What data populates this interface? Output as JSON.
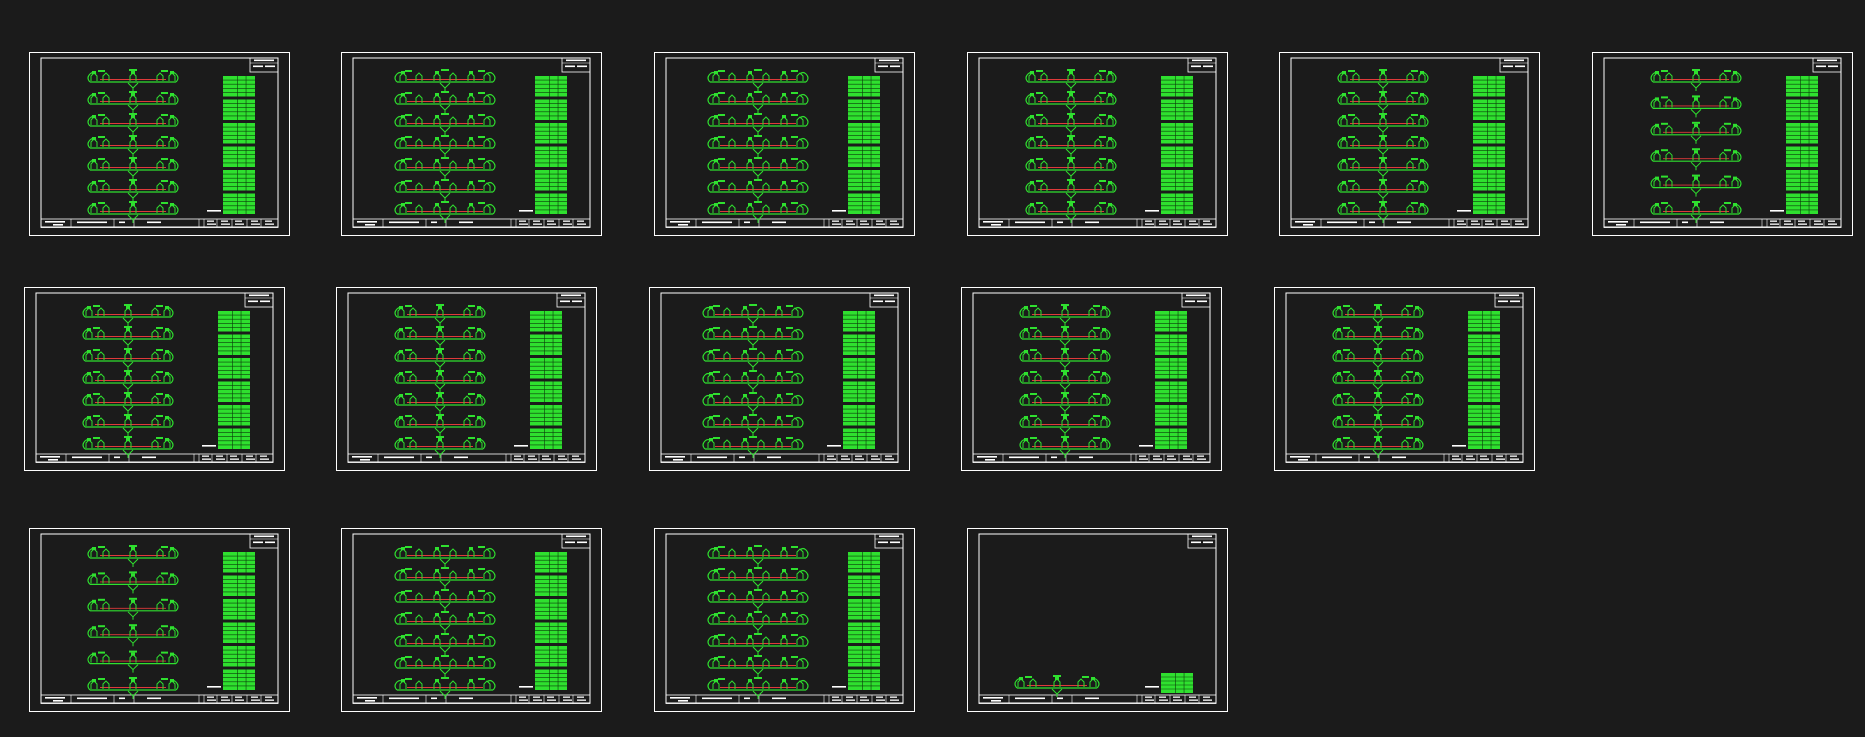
{
  "viewer": {
    "background": "#1b1b1b",
    "line_color": "#ffffff",
    "drawing_color": "#2fe02f",
    "rebar_color": "#e03a3a"
  },
  "sheets": [
    {
      "id": "sheet-1",
      "levels": 7,
      "table_blocks": 6,
      "variant": "a"
    },
    {
      "id": "sheet-2",
      "levels": 7,
      "table_blocks": 6,
      "variant": "b"
    },
    {
      "id": "sheet-3",
      "levels": 7,
      "table_blocks": 6,
      "variant": "b"
    },
    {
      "id": "sheet-4",
      "levels": 7,
      "table_blocks": 6,
      "variant": "a"
    },
    {
      "id": "sheet-5",
      "levels": 7,
      "table_blocks": 6,
      "variant": "a"
    },
    {
      "id": "sheet-6",
      "levels": 6,
      "table_blocks": 6,
      "variant": "a"
    },
    {
      "id": "sheet-7",
      "levels": 7,
      "table_blocks": 6,
      "variant": "a"
    },
    {
      "id": "sheet-8",
      "levels": 7,
      "table_blocks": 6,
      "variant": "a"
    },
    {
      "id": "sheet-9",
      "levels": 7,
      "table_blocks": 6,
      "variant": "b"
    },
    {
      "id": "sheet-10",
      "levels": 7,
      "table_blocks": 6,
      "variant": "a"
    },
    {
      "id": "sheet-11",
      "levels": 7,
      "table_blocks": 6,
      "variant": "a"
    },
    {
      "id": "sheet-12",
      "levels": 6,
      "table_blocks": 6,
      "variant": "a"
    },
    {
      "id": "sheet-13",
      "levels": 7,
      "table_blocks": 6,
      "variant": "b"
    },
    {
      "id": "sheet-14",
      "levels": 7,
      "table_blocks": 6,
      "variant": "b"
    },
    {
      "id": "sheet-15",
      "levels": 1,
      "table_blocks": 1,
      "variant": "a"
    }
  ]
}
